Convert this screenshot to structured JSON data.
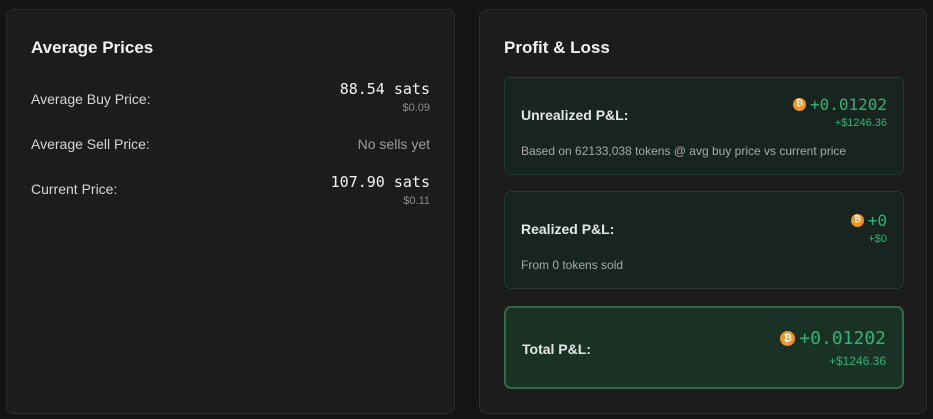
{
  "average_prices": {
    "title": "Average Prices",
    "rows": [
      {
        "label": "Average Buy Price:",
        "value": "88.54 sats",
        "sub": "$0.09"
      },
      {
        "label": "Average Sell Price:",
        "value": "No sells yet"
      },
      {
        "label": "Current Price:",
        "value": "107.90 sats",
        "sub": "$0.11"
      }
    ]
  },
  "profit_loss": {
    "title": "Profit & Loss",
    "unrealized": {
      "label": "Unrealized P&L:",
      "value": "+0.01202",
      "usd": "+$1246.36",
      "note": "Based on 62133,038 tokens @ avg buy price vs current price"
    },
    "realized": {
      "label": "Realized P&L:",
      "value": "+0",
      "usd": "+$0",
      "note": "From 0 tokens sold"
    },
    "total": {
      "label": "Total P&L:",
      "value": "+0.01202",
      "usd": "+$1246.36"
    }
  },
  "colors": {
    "positive": "#2bb673",
    "bitcoin": "#f7931a",
    "accent_border": "#2f6a45"
  },
  "icons": {
    "currency": "bitcoin-icon"
  }
}
